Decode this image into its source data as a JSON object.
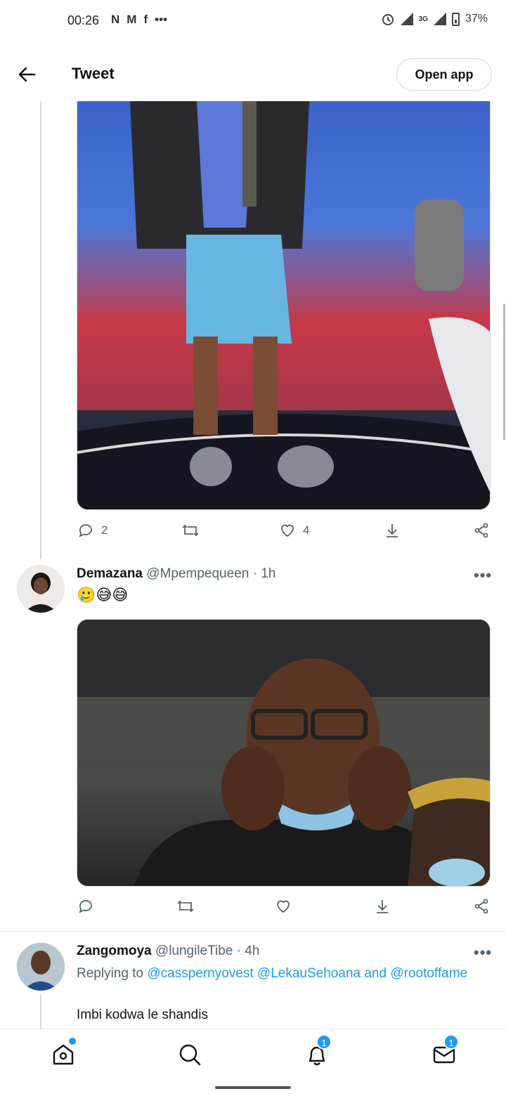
{
  "status_bar": {
    "time": "00:26",
    "notification_icons": [
      "N",
      "M",
      "f",
      "•••"
    ],
    "network": "3G",
    "battery": "37%"
  },
  "header": {
    "title": "Tweet",
    "open_app_label": "Open app"
  },
  "tweet_main": {
    "actions": {
      "replies": "2",
      "likes": "4"
    }
  },
  "tweet_demazana": {
    "name": "Demazana",
    "handle": "@Mpempequeen",
    "time": "· 1h",
    "text": "🥲😅😅",
    "more": "•••"
  },
  "tweet_zangomoya": {
    "name": "Zangomoya",
    "handle": "@lungileTibe",
    "time": "· 4h",
    "more": "•••",
    "reply_prefix": "Replying to",
    "reply_to_1": "@casspernyovest",
    "reply_to_2": "@LekauSehoana",
    "reply_and": "and",
    "reply_to_3": "@rootoffame",
    "text": "Imbi kodwa le shandis"
  },
  "bottom_nav": {
    "notifications_badge": "1",
    "messages_badge": "1",
    "icons": [
      "home-icon",
      "search-icon",
      "bell-icon",
      "mail-icon"
    ]
  },
  "colors": {
    "accent": "#1d9bf0",
    "text_secondary": "#536471",
    "border": "#cfd9de"
  }
}
